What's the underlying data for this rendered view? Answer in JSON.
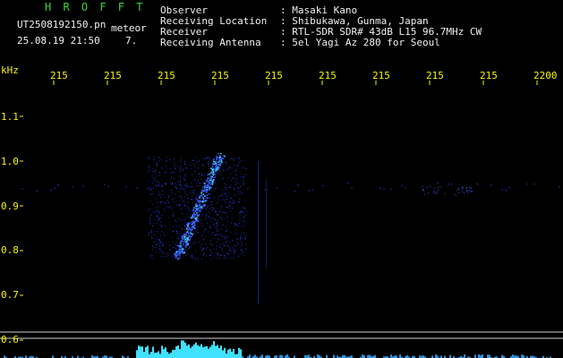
{
  "header": {
    "title": "H R O F F T",
    "filename": "UT2508192150.pn",
    "meteor_label": "meteor",
    "datetime": "25.08.19 21:50",
    "count": "7.",
    "observer_label": "Observer",
    "observer_value": ": Masaki Kano",
    "location_label": "Receiving Location",
    "location_value": ": Shibukawa, Gunma, Japan",
    "receiver_label": "Receiver",
    "receiver_value": ": RTL-SDR SDR# 43dB L15 96.7MHz CW",
    "antenna_label": "Receiving Antenna",
    "antenna_value": ": 5el Yagi Az 280 for Seoul"
  },
  "axis": {
    "y_unit": "kHz",
    "y_ticks": [
      "1.1",
      "1.0",
      "0.9",
      "0.8",
      "0.7",
      "0.6"
    ],
    "x_ticks": [
      "215",
      "215",
      "215",
      "215",
      "215",
      "215",
      "215",
      "215",
      "215",
      "2200"
    ]
  },
  "colors": {
    "background": "#000000",
    "text_green": "#3cd23c",
    "text_white": "#f0f0f0",
    "text_yellow": "#f5f500",
    "signal_blue": "#3b5bff",
    "signal_cyan": "#40e0ff"
  }
}
